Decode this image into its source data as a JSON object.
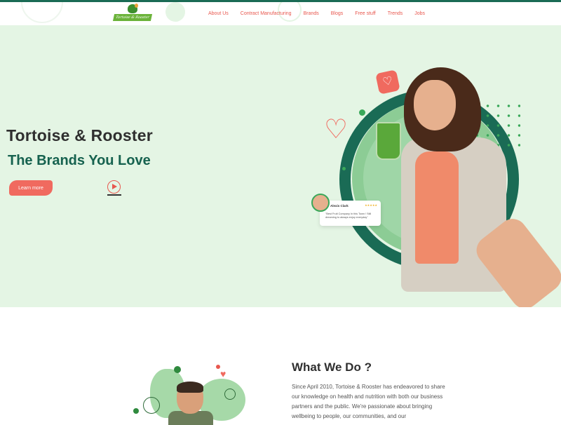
{
  "header": {
    "logo_text": "Tortoise & Rooster",
    "nav": [
      "About Us",
      "Contract Manufacturing",
      "Brands",
      "Blogs",
      "Free stuff",
      "Trends",
      "Jobs"
    ]
  },
  "hero": {
    "title": "Tortoise & Rooster",
    "subtitle": "The Brands You Love",
    "learn_more": "Learn more",
    "review": {
      "name": "Alexis Clark",
      "stars": "★★★★★",
      "text": "\"Best Fruit Company In this Town ! Still dreaming to always enjoy everyday\""
    }
  },
  "what_we_do": {
    "title": "What We Do ?",
    "text": "Since April 2010, Tortoise & Rooster has endeavored to share our knowledge on health and nutrition with both our business partners and the public. We're passionate about bringing wellbeing to people, our communities, and our"
  },
  "colors": {
    "accent": "#e8574e",
    "brand_green": "#1a6b55",
    "hero_bg": "#e4f5e4"
  },
  "icons": [
    "heart-icon",
    "play-icon",
    "star-icon"
  ]
}
